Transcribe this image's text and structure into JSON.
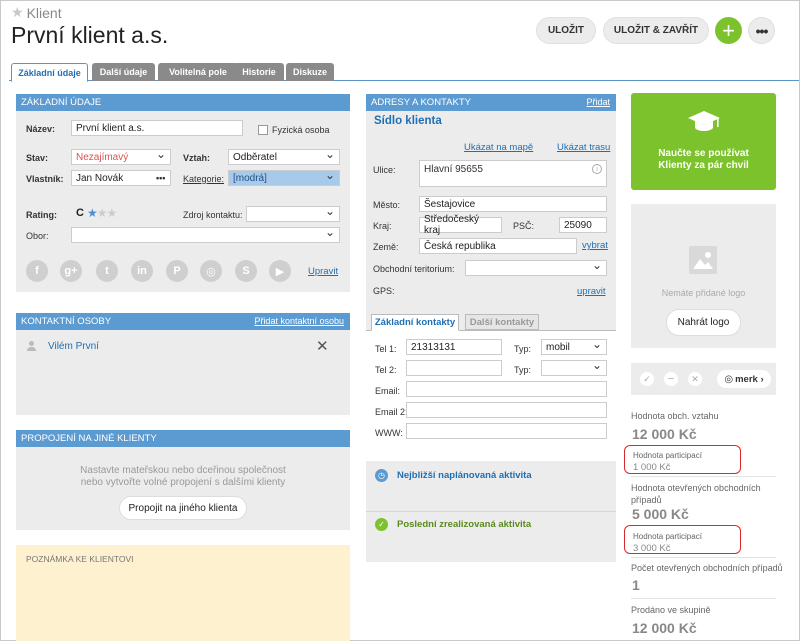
{
  "header": {
    "breadcrumb": "Klient",
    "title": "První klient a.s.",
    "save_label": "ULOŽIT",
    "save_close_label": "ULOŽIT & ZAVŘÍT",
    "plus": "+",
    "more": "•••"
  },
  "tabs": [
    "Základní údaje",
    "Další údaje",
    "Volitelná pole",
    "Historie",
    "Diskuze"
  ],
  "basic": {
    "heading": "ZÁKLADNÍ ÚDAJE",
    "name_label": "Název:",
    "name_value": "První klient a.s.",
    "person_label": "Fyzická osoba",
    "state_label": "Stav:",
    "state_value": "Nezajímavý",
    "relation_label": "Vztah:",
    "relation_value": "Odběratel",
    "owner_label": "Vlastník:",
    "owner_value": "Jan Novák",
    "owner_more": "•••",
    "category_label": "Kategorie:",
    "category_value": "[modrá]",
    "rating_label": "Rating:",
    "rating_value": "C",
    "source_label": "Zdroj kontaktu:",
    "field_label": "Obor:",
    "edit_label": "Upravit"
  },
  "contacts": {
    "heading": "KONTAKTNÍ OSOBY",
    "add_label": "Přidat kontaktní osobu",
    "person": "Vilém První"
  },
  "links": {
    "heading": "PROPOJENÍ NA JINÉ KLIENTY",
    "text1": "Nastavte mateřskou nebo dceřinou společnost",
    "text2": "nebo vytvořte volné propojení s dalšími klienty",
    "button": "Propojit na jiného klienta"
  },
  "note": {
    "heading": "POZNÁMKA KE KLIENTOVI"
  },
  "address": {
    "heading": "ADRESY A KONTAKTY",
    "add_label": "Přidat",
    "subtitle": "Sídlo klienta",
    "map_label": "Ukázat na mapě",
    "route_label": "Ukázat trasu",
    "street_label": "Ulice:",
    "street_value": "Hlavní 95655",
    "city_label": "Město:",
    "city_value": "Šestajovice",
    "region_label": "Kraj:",
    "region_value": "Středočeský kraj",
    "zip_label": "PSČ:",
    "zip_value": "25090",
    "country_label": "Země:",
    "country_value": "Česká republika",
    "choose_label": "vybrat",
    "territory_label": "Obchodní teritorium:",
    "gps_label": "GPS:",
    "gps_edit": "upravit"
  },
  "contact_tabs": [
    "Základní kontakty",
    "Další kontakty"
  ],
  "phones": {
    "tel1_label": "Tel 1:",
    "tel1_value": "21313131",
    "type_label": "Typ:",
    "type1_value": "mobil",
    "tel2_label": "Tel 2:",
    "type2_label": "Typ:",
    "email_label": "Email:",
    "email2_label": "Email 2:",
    "www_label": "WWW:"
  },
  "activity": {
    "next": "Nejbližší naplánovaná aktivita",
    "last": "Poslední zrealizovaná aktivita"
  },
  "promo": {
    "line1": "Naučte se používat",
    "line2": "Klienty za pár chvil"
  },
  "logo": {
    "text": "Nemáte přidané logo",
    "button": "Nahrát logo"
  },
  "merk": {
    "label": "merk ›"
  },
  "stats": {
    "rel_title": "Hodnota obch. vztahu",
    "rel_value": "12 000 Kč",
    "part1_title": "Hodnota participací",
    "part1_value": "1 000 Kč",
    "open_title1": "Hodnota otevřených obchodních",
    "open_title2": "případů",
    "open_value": "5 000 Kč",
    "part2_title": "Hodnota participací",
    "part2_value": "3 000 Kč",
    "count_title": "Počet otevřených obchodních případů",
    "count_value": "1",
    "group_title": "Prodáno ve skupině",
    "group_value": "12 000 Kč"
  },
  "colors": {
    "accent": "#5b9bd1",
    "green": "#7cc22c",
    "state_red": "#d9534f",
    "highlight": "#d82a2a"
  }
}
